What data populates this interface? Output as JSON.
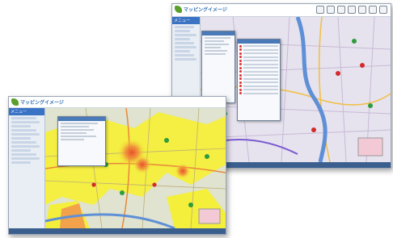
{
  "screens": {
    "back": {
      "logo_text": "マッピングイメージ",
      "sidebar_header": "メニュー"
    },
    "front": {
      "logo_text": "マッピングイメージ",
      "sidebar_header": "メニュー"
    }
  },
  "icons": {
    "logo": "map-pin-logo-icon",
    "tools": [
      "print-icon",
      "zoom-in-icon",
      "zoom-out-icon",
      "ruler-icon",
      "layers-icon",
      "help-icon",
      "close-icon"
    ]
  },
  "colors": {
    "back_map_bg": "#e6e3ee",
    "river": "#5f8fd6",
    "front_map_bg": "#dfe3cf",
    "area_yellow": "#f4ef3a",
    "area_orange": "#f2a24a",
    "heat": "#e8512b",
    "marker_green": "#2e9b3c",
    "marker_red": "#d42a2a"
  }
}
